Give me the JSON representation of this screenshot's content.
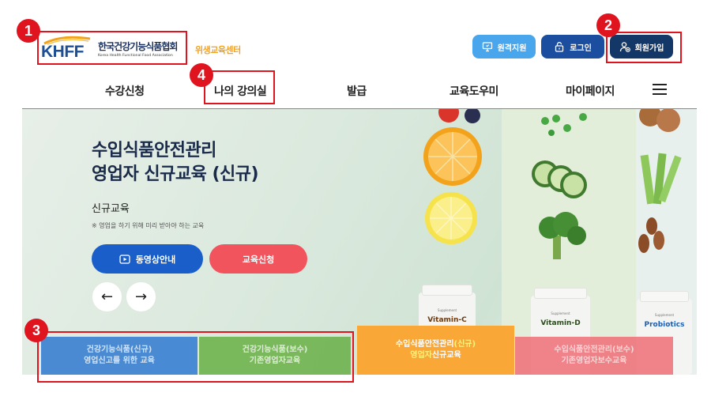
{
  "header": {
    "logo": {
      "mark": "KHFF",
      "name_ko": "한국건강기능식품협회",
      "name_en": "Korea Health Functional Food Association"
    },
    "subtitle": "위생교육센터",
    "buttons": {
      "remote": "원격지원",
      "login": "로그인",
      "join": "회원가입"
    }
  },
  "nav": {
    "items": [
      "수강신청",
      "나의 강의실",
      "발급",
      "교육도우미",
      "마이페이지"
    ],
    "menu_icon": "hamburger-icon"
  },
  "hero": {
    "title_line1": "수입식품안전관리",
    "title_line2": "영업자 신규교육 (신규)",
    "subtitle": "신규교육",
    "note": "※ 영업을 하기 위해 미리 받아야 하는 교육",
    "video_button": "동영상안내",
    "apply_button": "교육신청",
    "prev_arrow": "←",
    "next_arrow": "→",
    "bottles": {
      "supplement_text": "Supplement",
      "vitamin_c": "Vitamin-C",
      "vitamin_d": "Vitamin-D",
      "probiotics": "Probiotics"
    }
  },
  "tabs": [
    {
      "line1": "건강기능식품(신규)",
      "line2": "영업신고를 위한 교육"
    },
    {
      "line1": "건강기능식품(보수)",
      "line2": "기존영업자교육"
    },
    {
      "line1_a": "수입식품안전관리",
      "line1_b": "(신규)",
      "line2_a": "영업자",
      "line2_b": "신규교육"
    },
    {
      "line1": "수입식품안전관리(보수)",
      "line2": "기존영업자보수교육"
    }
  ],
  "annotations": [
    "1",
    "2",
    "3",
    "4"
  ],
  "colors": {
    "brand_navy": "#133766",
    "brand_blue": "#1c4ea0",
    "accent_orange": "#f9a736",
    "accent_red": "#f2545d",
    "annotation_red": "#e0141f"
  }
}
